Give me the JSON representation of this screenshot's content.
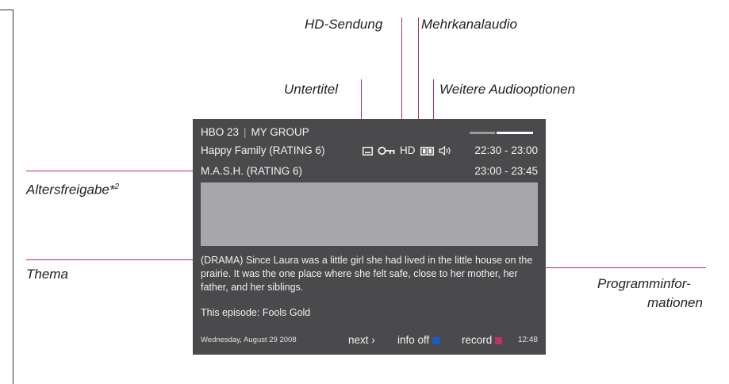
{
  "callouts": {
    "hd": "HD-Sendung",
    "multichannel": "Mehrkanalaudio",
    "subtitles": "Untertitel",
    "more_audio": "Weitere Audiooptionen",
    "age_rating": "Altersfreigabe*",
    "age_rating_sup": "2",
    "topic": "Thema",
    "program_info_1": "Programminfor-",
    "program_info_2": "mationen"
  },
  "tv": {
    "channel": "HBO 23",
    "group": "MY GROUP",
    "now": {
      "title": "Happy Family (RATING 6)",
      "time": "22:30 - 23:00"
    },
    "next_prog": {
      "title": "M.A.S.H. (RATING 6)",
      "time": "23:00 - 23:45"
    },
    "hd_label": "HD",
    "description": "(DRAMA) Since Laura was a little girl she had lived in the little house on the prairie. It was the one place where she felt safe, close to her mother, her father, and her siblings.",
    "episode": "This episode: Fools Gold",
    "footer": {
      "date": "Wednesday, August 29 2008",
      "next": "next ›",
      "info_off": "info off",
      "record": "record",
      "clock": "12:48"
    }
  },
  "colors": {
    "leader": "#b03060",
    "panel": "#4a4a4c",
    "info_off_key": "#1e5bc6",
    "record_key": "#c0306a"
  },
  "icons": [
    "subtitle-icon",
    "key-lock-icon",
    "hd-icon",
    "dolby-icon",
    "speaker-icon"
  ]
}
